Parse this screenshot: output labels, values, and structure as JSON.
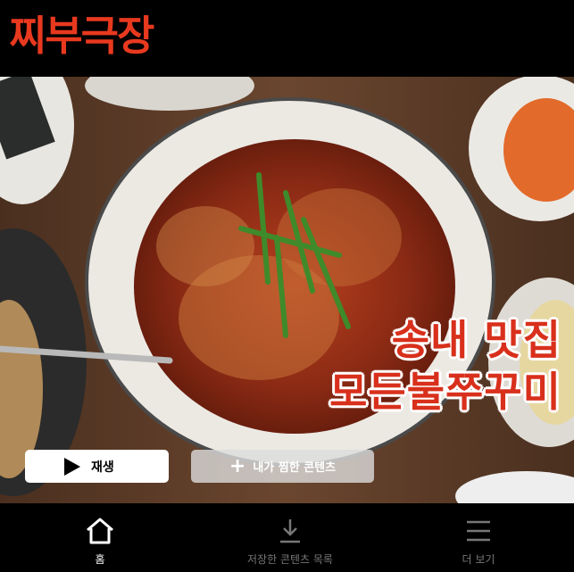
{
  "app": {
    "logo": "찌부극장"
  },
  "hero": {
    "title_line1": "송내 맛집",
    "title_line2": "모든불쭈꾸미",
    "play_label": "재생",
    "mylist_label": "내가 찜한 콘텐츠",
    "play_icon": "play-icon",
    "plus_icon": "plus-icon"
  },
  "bottom_nav": [
    {
      "label": "홈",
      "icon": "home-icon",
      "active": true
    },
    {
      "label": "저장한 콘텐츠 목록",
      "icon": "download-icon",
      "active": false
    },
    {
      "label": "더 보기",
      "icon": "menu-icon",
      "active": false
    }
  ],
  "colors": {
    "brand": "#e8391f",
    "background": "#000000"
  }
}
